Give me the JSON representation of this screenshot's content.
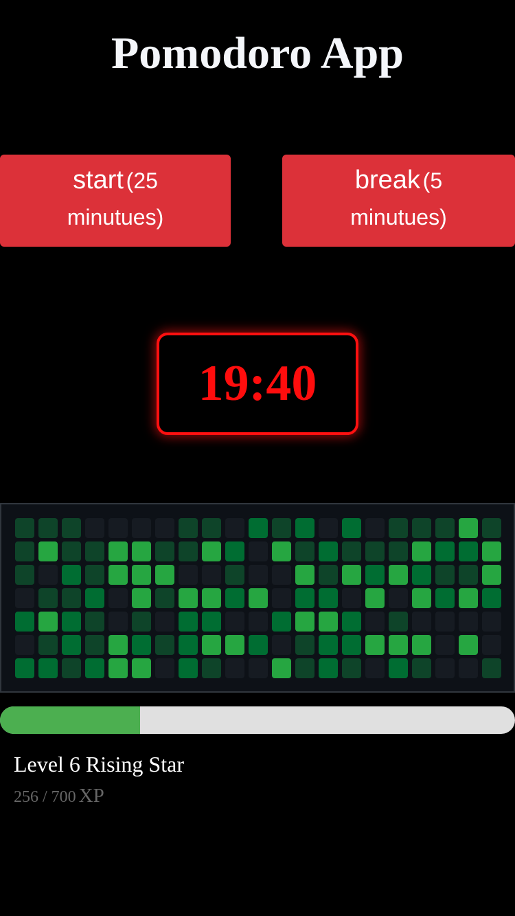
{
  "app": {
    "title": "Pomodoro App"
  },
  "buttons": {
    "start": {
      "label": "start",
      "sub": "(25 minutues)"
    },
    "break": {
      "label": "break",
      "sub": "(5 minutues)"
    }
  },
  "timer": {
    "display": "19:40"
  },
  "activity": {
    "colors": [
      "#161b22",
      "#0e4429",
      "#006d32",
      "#26a641",
      "#39d353"
    ],
    "rows": [
      [
        1,
        1,
        1,
        0,
        0,
        0,
        0,
        1,
        1,
        0,
        2,
        1,
        2,
        0,
        2,
        0,
        1,
        1,
        1,
        3,
        1
      ],
      [
        1,
        3,
        1,
        1,
        3,
        3,
        1,
        1,
        3,
        2,
        0,
        3,
        1,
        2,
        1,
        1,
        1,
        3,
        2,
        2,
        3
      ],
      [
        1,
        0,
        2,
        1,
        3,
        3,
        3,
        0,
        0,
        1,
        0,
        0,
        3,
        1,
        3,
        2,
        3,
        2,
        1,
        1,
        3
      ],
      [
        0,
        1,
        1,
        2,
        0,
        3,
        1,
        3,
        3,
        2,
        3,
        0,
        2,
        2,
        0,
        3,
        0,
        3,
        2,
        3,
        2
      ],
      [
        2,
        3,
        2,
        1,
        0,
        1,
        0,
        2,
        2,
        0,
        0,
        2,
        3,
        3,
        2,
        0,
        1,
        0,
        0,
        0,
        0
      ],
      [
        0,
        1,
        2,
        1,
        3,
        2,
        1,
        2,
        3,
        3,
        2,
        0,
        1,
        2,
        2,
        3,
        3,
        3,
        0,
        3,
        0
      ],
      [
        2,
        2,
        1,
        2,
        3,
        3,
        0,
        2,
        1,
        0,
        0,
        3,
        1,
        2,
        1,
        0,
        2,
        1,
        0,
        0,
        1
      ]
    ]
  },
  "progress": {
    "fraction": 0.272,
    "color": "#4caf50"
  },
  "level": {
    "label": "Level 6 Rising Star",
    "xp_current": "256",
    "xp_separator": " / ",
    "xp_max": "700",
    "xp_unit": "XP"
  }
}
